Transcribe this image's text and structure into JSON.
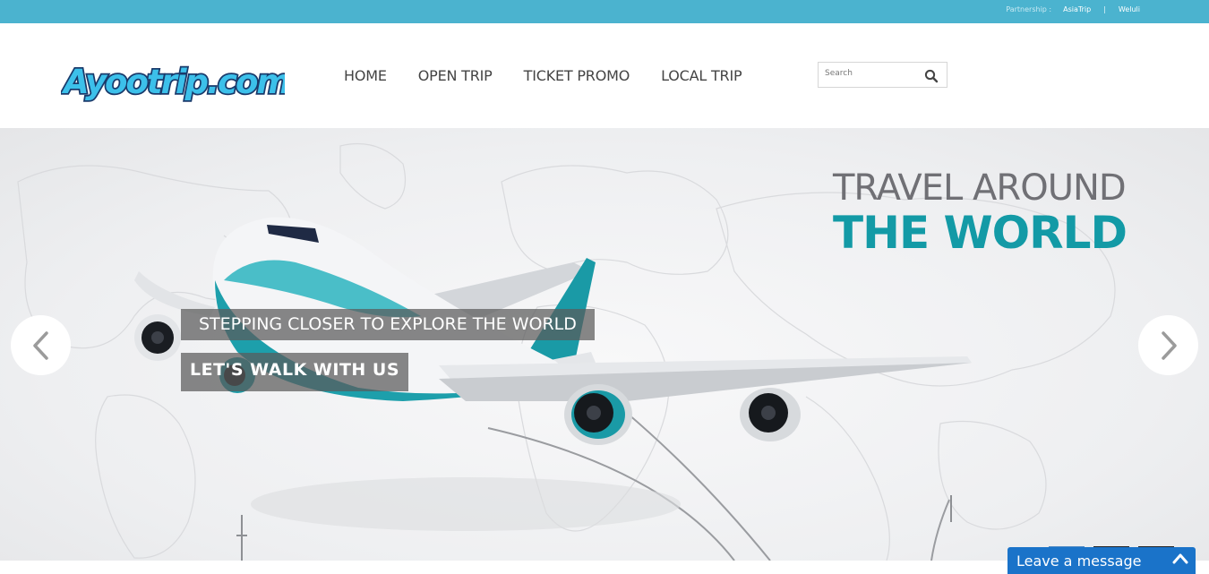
{
  "topbar": {
    "partnership_label": "Partnership :",
    "partners": [
      "AsiaTrip",
      "Weluli"
    ],
    "separator": "|"
  },
  "brand": {
    "logo_text": "Ayootrip.com",
    "logo_fill": "#3cc0ea",
    "logo_stroke": "#1a3a6b"
  },
  "nav": {
    "items": [
      "HOME",
      "OPEN TRIP",
      "TICKET PROMO",
      "LOCAL TRIP"
    ]
  },
  "search": {
    "placeholder": "Search",
    "icon": "search-icon"
  },
  "hero": {
    "headline_line1": "TRAVEL AROUND",
    "headline_line2": "THE WORLD",
    "caption_primary": "STEPPING CLOSER TO EXPLORE THE WORLD",
    "caption_secondary": "LET'S WALK WITH US",
    "prev_icon": "chevron-left-icon",
    "next_icon": "chevron-right-icon",
    "slide_count": 3,
    "active_slide": 1
  },
  "chat": {
    "label": "Leave a message",
    "icon": "chevron-up-icon"
  },
  "colors": {
    "topbar": "#4bb3cf",
    "accent_teal": "#139aa6",
    "headline_gray": "#707075",
    "chat_blue": "#1a73c9"
  }
}
